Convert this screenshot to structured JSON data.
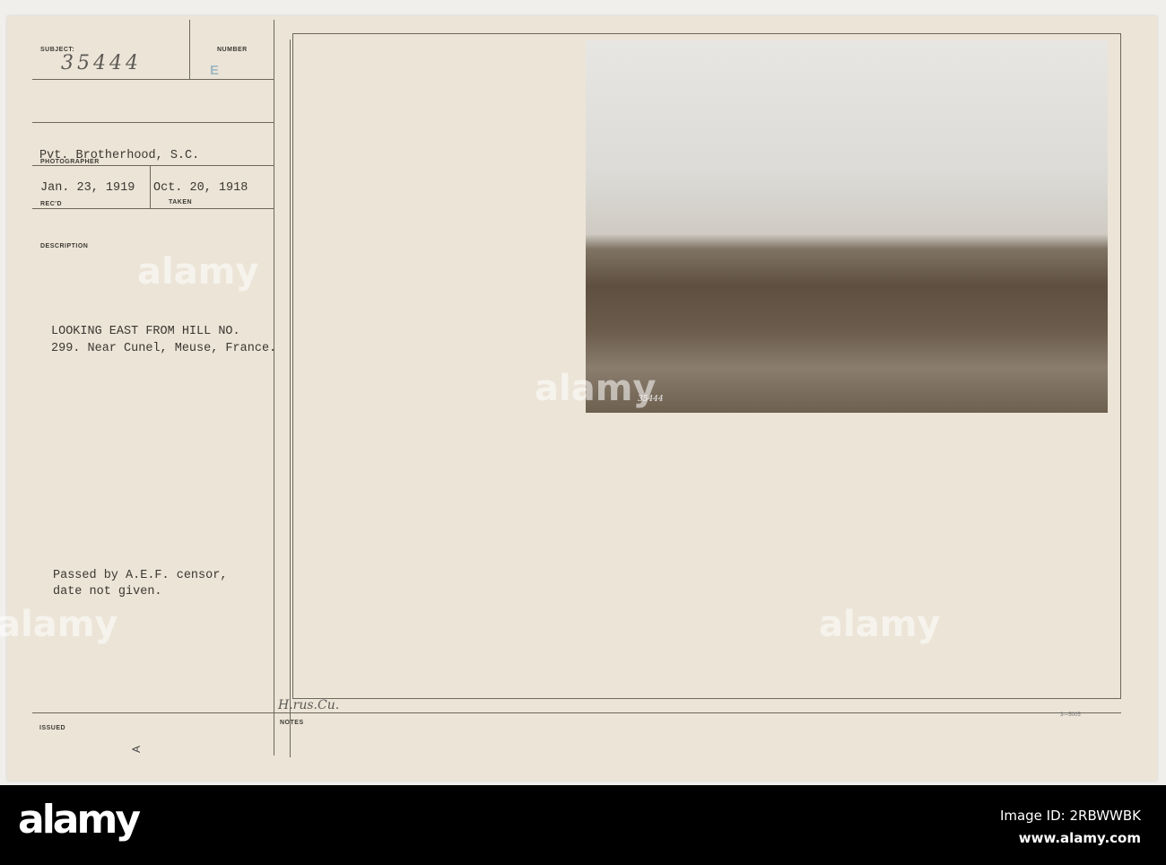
{
  "card": {
    "subject_label": "SUBJECT:",
    "subject_number": "35444",
    "number_label": "NUMBER",
    "number_stamp": "E",
    "photographer_label": "PHOTOGRAPHER",
    "photographer": "Pvt. Brotherhood, S.C.",
    "received_date": "Jan. 23, 1919",
    "received_label": "REC'D",
    "taken_date": "Oct. 20, 1918",
    "taken_label": "TAKEN",
    "description_label": "DESCRIPTION",
    "description_line1": "LOOKING EAST FROM HILL NO.",
    "description_line2": "299. Near Cunel, Meuse, France.",
    "censor_line1": "Passed by A.E.F. censor,",
    "censor_line2": "date not given.",
    "issued_label": "ISSUED",
    "issued_mark": "A",
    "notes_label": "NOTES",
    "handwritten_note": "H.rus.Cu.",
    "form_number": "3—5005",
    "photo_number": "35444"
  },
  "watermark": "alamy",
  "footer": {
    "logo": "alamy",
    "image_id": "Image ID: 2RBWWBK",
    "url": "www.alamy.com"
  }
}
